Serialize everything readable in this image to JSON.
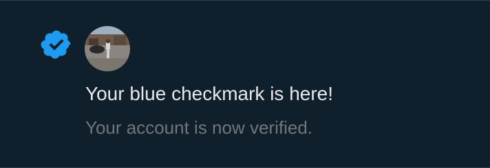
{
  "notification": {
    "icon": "verified-badge-icon",
    "accent_color": "#1d9bf0",
    "avatar": "profile-photo-avatar",
    "title": "Your blue checkmark is here!",
    "message": "Your account is now verified."
  }
}
